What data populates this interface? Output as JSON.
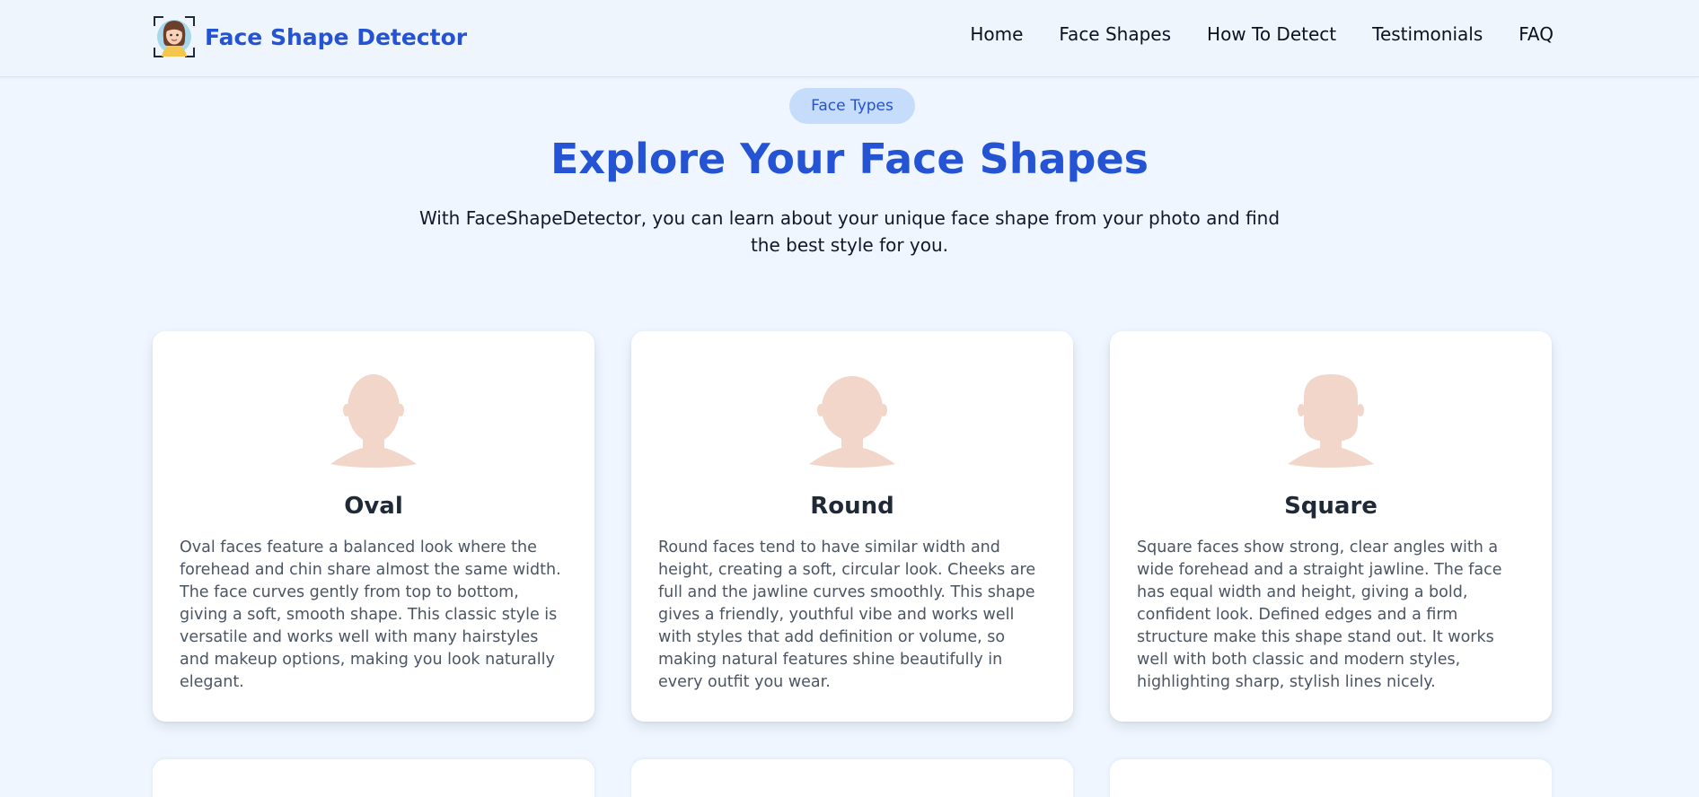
{
  "header": {
    "brand_name": "Face Shape Detector",
    "logo_icon": "girl-face-scan-icon",
    "nav": [
      "Home",
      "Face Shapes",
      "How To Detect",
      "Testimonials",
      "FAQ"
    ]
  },
  "section": {
    "badge": "Face Types",
    "title": "Explore Your Face Shapes",
    "subtitle": "With FaceShapeDetector, you can learn about your unique face shape from your photo and find the best style for you."
  },
  "cards": [
    {
      "name": "Oval",
      "icon": "oval-face-silhouette-icon",
      "description": "Oval faces feature a balanced look where the forehead and chin share almost the same width. The face curves gently from top to bottom, giving a soft, smooth shape. This classic style is versatile and works well with many hairstyles and makeup options, making you look naturally elegant."
    },
    {
      "name": "Round",
      "icon": "round-face-silhouette-icon",
      "description": "Round faces tend to have similar width and height, creating a soft, circular look. Cheeks are full and the jawline curves smoothly. This shape gives a friendly, youthful vibe and works well with styles that add definition or volume, so making natural features shine beautifully in every outfit you wear."
    },
    {
      "name": "Square",
      "icon": "square-face-silhouette-icon",
      "description": "Square faces show strong, clear angles with a wide forehead and a straight jawline. The face has equal width and height, giving a bold, confident look. Defined edges and a firm structure make this shape stand out. It works well with both classic and modern styles, highlighting sharp, stylish lines nicely."
    }
  ],
  "colors": {
    "brand": "#2453d3",
    "page_background": "#eff6ff",
    "badge_background": "#c6dcfb",
    "silhouette": "#f2d6c9"
  }
}
